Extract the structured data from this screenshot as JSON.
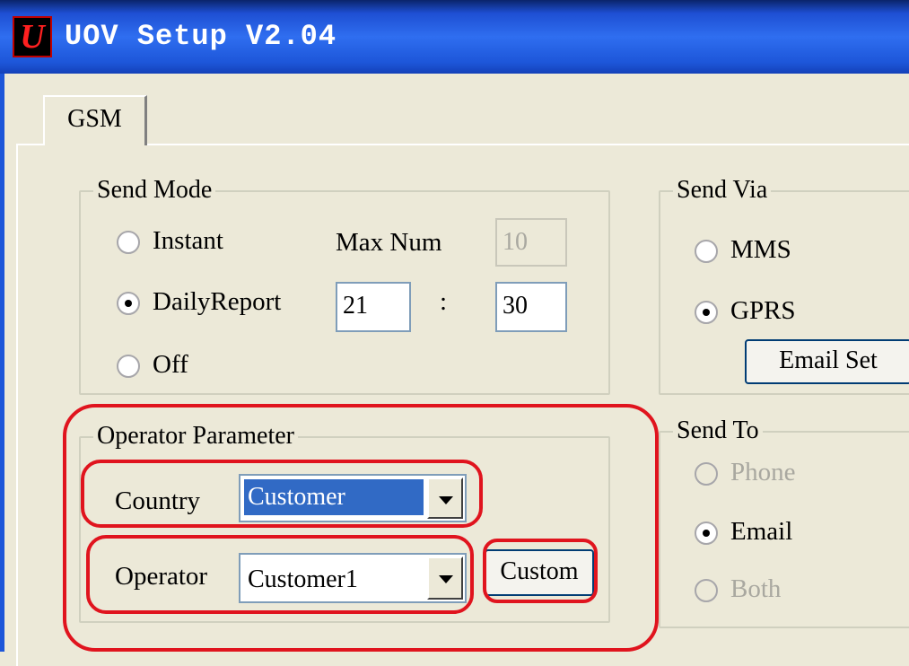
{
  "window": {
    "title": "UOV Setup V2.04",
    "logo_letter": "U"
  },
  "tabs": [
    {
      "label": "GSM"
    }
  ],
  "send_mode": {
    "title": "Send Mode",
    "options": [
      {
        "label": "Instant",
        "checked": false
      },
      {
        "label": "DailyReport",
        "checked": true
      },
      {
        "label": "Off",
        "checked": false
      }
    ],
    "max_num_label": "Max Num",
    "max_num_value": "10",
    "hour_value": "21",
    "separator": ":",
    "minute_value": "30"
  },
  "send_via": {
    "title": "Send Via",
    "options": [
      {
        "label": "MMS",
        "checked": false
      },
      {
        "label": "GPRS",
        "checked": true
      }
    ],
    "email_set_label": "Email Set"
  },
  "operator_parameter": {
    "title": "Operator Parameter",
    "country_label": "Country",
    "country_value": "Customer",
    "operator_label": "Operator",
    "operator_value": "Customer1",
    "custom_button_label": "Custom"
  },
  "send_to": {
    "title": "Send To",
    "options": [
      {
        "label": "Phone",
        "checked": false,
        "enabled": false
      },
      {
        "label": "Email",
        "checked": true,
        "enabled": true
      },
      {
        "label": "Both",
        "checked": false,
        "enabled": false
      }
    ]
  },
  "colors": {
    "titlebar": "#2f6ef0",
    "highlight_annotation": "#e0141e",
    "selection": "#316ac5"
  }
}
